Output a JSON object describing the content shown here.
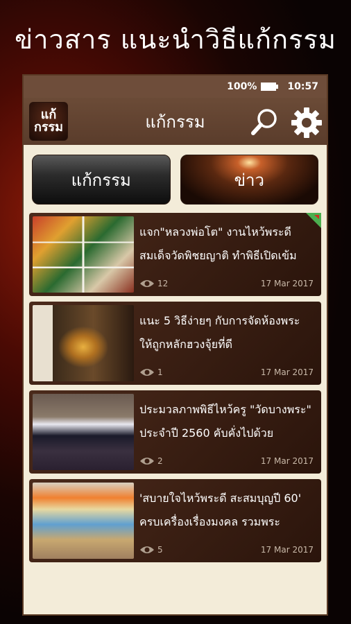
{
  "promo": {
    "title": "ข่าวสาร แนะนำวิธีแก้กรรม"
  },
  "status": {
    "battery": "100%",
    "time": "10:57"
  },
  "appbar": {
    "logo_line1": "แก้",
    "logo_line2": "กรรม",
    "title": "แก้กรรม",
    "icons": [
      "search-icon",
      "gear-icon"
    ]
  },
  "tabs": [
    {
      "label": "แก้กรรม"
    },
    {
      "label": "ข่าว"
    }
  ],
  "articles": [
    {
      "title": "แจก\"หลวงพ่อโต\" งานไหว้พระดี สมเด็จวัดพิชยญาติ ทำพิธีเปิดเข้ม",
      "views": "12",
      "date": "17 Mar 2017"
    },
    {
      "title": "แนะ 5 วิธีง่ายๆ กับการจัดห้องพระให้ถูกหลักฮวงจุ้ยที่ดี",
      "views": "1",
      "date": "17 Mar 2017"
    },
    {
      "title": "ประมวลภาพพิธีไหว้ครู \"วัดบางพระ\" ประจำปี 2560 คับคั่งไปด้วย",
      "views": "2",
      "date": "17 Mar 2017"
    },
    {
      "title": "'สบายใจไหว้พระดี สะสมบุญปี 60' ครบเครื่องเรื่องมงคล รวมพระ",
      "views": "5",
      "date": "17 Mar 2017"
    }
  ],
  "colors": {
    "appbar": "#6b4b37",
    "card": "#3a1e12",
    "content_bg": "#f3ecd9"
  }
}
